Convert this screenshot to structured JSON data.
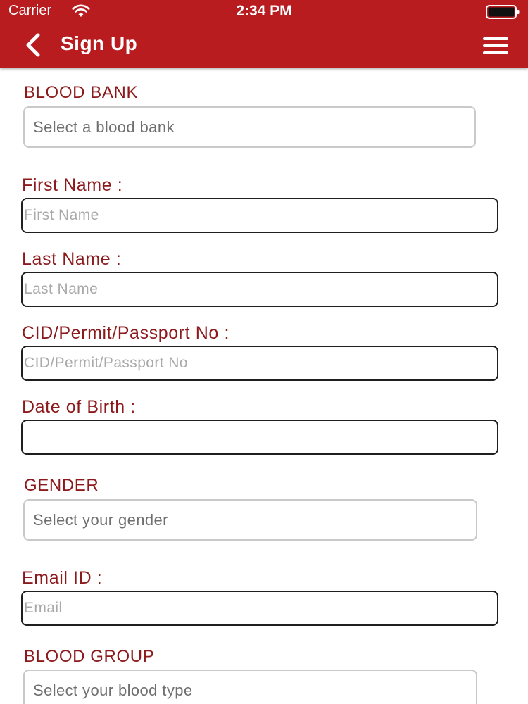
{
  "status_bar": {
    "carrier": "Carrier",
    "time": "2:34 PM"
  },
  "header": {
    "title": "Sign Up",
    "accent_color": "#b81c1f",
    "back_icon": "chevron-left-icon",
    "menu_icon": "hamburger-menu-icon"
  },
  "form": {
    "label_color": "#8c1a1c",
    "blood_bank": {
      "label": "BLOOD BANK",
      "placeholder": "Select a blood bank"
    },
    "first_name": {
      "label": "First Name :",
      "placeholder": "First Name",
      "value": ""
    },
    "last_name": {
      "label": "Last Name :",
      "placeholder": "Last Name",
      "value": ""
    },
    "cid": {
      "label": "CID/Permit/Passport No :",
      "placeholder": "CID/Permit/Passport No",
      "value": ""
    },
    "dob": {
      "label": "Date of Birth :",
      "placeholder": "",
      "value": ""
    },
    "gender": {
      "label": "GENDER",
      "placeholder": "Select your gender"
    },
    "email": {
      "label": "Email ID :",
      "placeholder": "Email",
      "value": ""
    },
    "blood_group": {
      "label": "BLOOD GROUP",
      "placeholder": "Select your blood type"
    }
  }
}
